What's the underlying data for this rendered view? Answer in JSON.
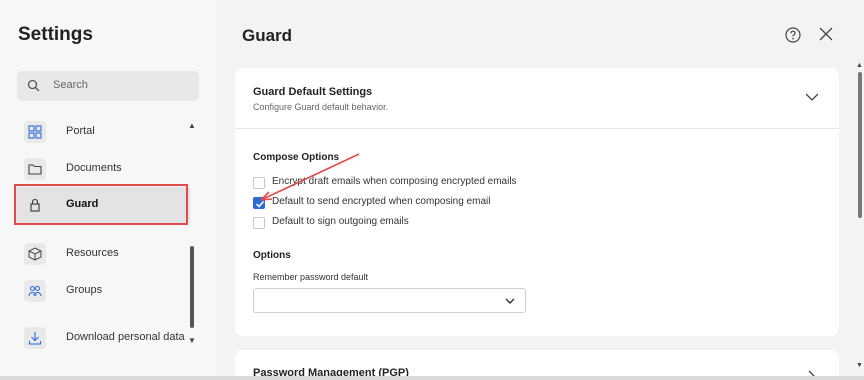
{
  "sidebar": {
    "title": "Settings",
    "search_placeholder": "Search",
    "items": [
      {
        "label": "Portal",
        "icon": "grid-icon"
      },
      {
        "label": "Documents",
        "icon": "folder-icon"
      },
      {
        "label": "Guard",
        "icon": "lock-icon",
        "active": true
      },
      {
        "label": "Resources",
        "icon": "cube-icon"
      },
      {
        "label": "Groups",
        "icon": "group-icon"
      },
      {
        "label": "Download personal data",
        "icon": "download-icon"
      }
    ]
  },
  "main": {
    "title": "Guard",
    "help_icon": "help-icon",
    "close_icon": "close-icon"
  },
  "card": {
    "title": "Guard Default Settings",
    "subtitle": "Configure Guard default behavior.",
    "compose_heading": "Compose Options",
    "checkboxes": [
      {
        "label": "Encrypt draft emails when composing encrypted emails",
        "checked": false
      },
      {
        "label": "Default to send encrypted when composing email",
        "checked": true
      },
      {
        "label": "Default to sign outgoing emails",
        "checked": false
      }
    ],
    "options_heading": "Options",
    "remember_label": "Remember password default",
    "remember_value": ""
  },
  "card2": {
    "title": "Password Management (PGP)"
  },
  "colors": {
    "accent": "#2c6bd6",
    "highlight": "#e04b4b",
    "arrow": "#e04b4b"
  }
}
